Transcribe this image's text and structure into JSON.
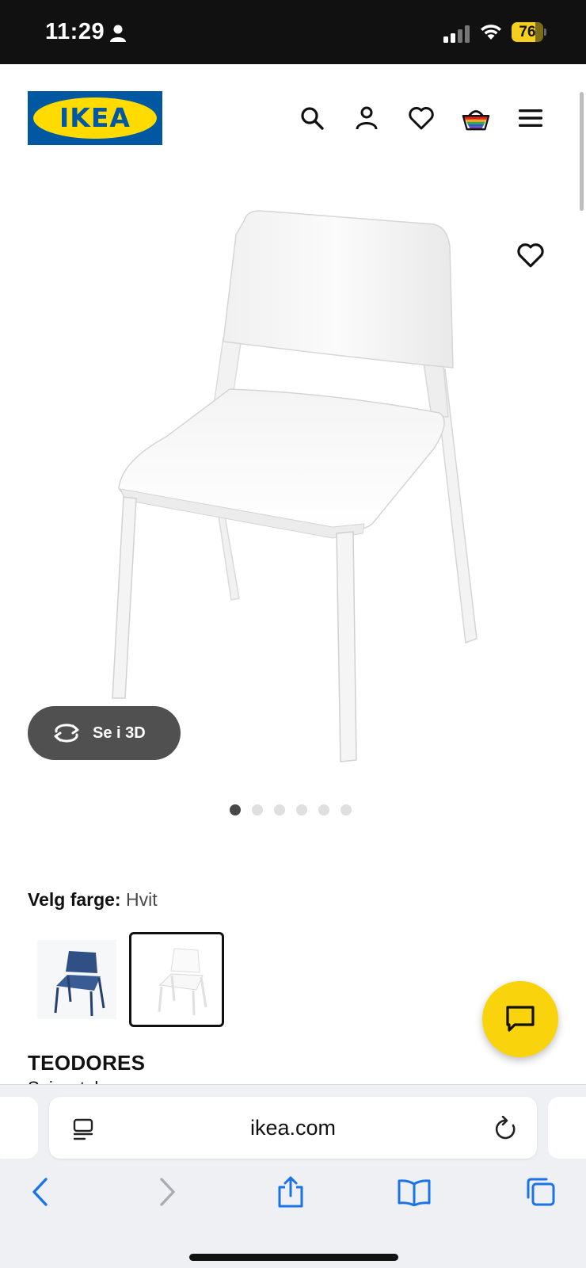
{
  "status_bar": {
    "time": "11:29",
    "battery_percent": "76",
    "battery_level": 0.76
  },
  "header": {
    "logo_text": "IKEA",
    "logo_reg": "®",
    "colors": {
      "brand_blue": "#0058a3",
      "brand_yellow": "#ffdb00"
    },
    "icons": [
      "search-icon",
      "account-icon",
      "favorites-icon",
      "cart-icon",
      "menu-icon"
    ]
  },
  "gallery": {
    "view_3d_label": "Se i 3D",
    "image_count": 6,
    "active_index": 0
  },
  "color_select": {
    "label": "Velg farge:",
    "value": "Hvit",
    "options": [
      {
        "name": "Blå",
        "color": "#2f4f85",
        "selected": false
      },
      {
        "name": "Hvit",
        "color": "#ffffff",
        "selected": true
      }
    ]
  },
  "product": {
    "name": "TEODORES",
    "subtitle": "Spisestol"
  },
  "chat": {
    "color": "#f9d40d"
  },
  "browser": {
    "url": "ikea.com",
    "accent": "#1a73e8"
  }
}
